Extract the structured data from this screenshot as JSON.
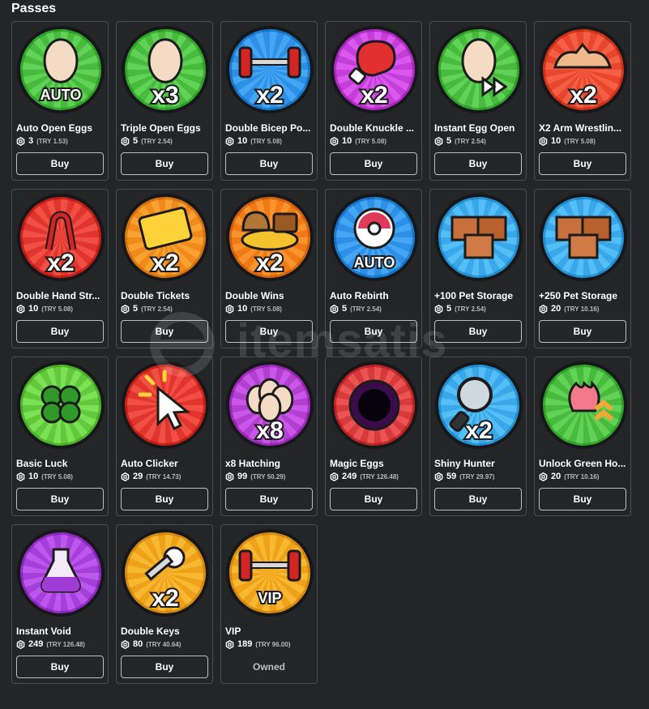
{
  "section_title": "Passes",
  "buy_label": "Buy",
  "watermark_text": "itemsatis",
  "passes": [
    {
      "name": "Auto Open Eggs",
      "price": "3",
      "try": "(TRY 1.53)",
      "icon": "egg-auto",
      "bg": "#48bb3f",
      "label": "AUTO",
      "status": "buy"
    },
    {
      "name": "Triple Open Eggs",
      "price": "5",
      "try": "(TRY 2.54)",
      "icon": "egg-x3",
      "bg": "#48bb3f",
      "label": "x3",
      "status": "buy"
    },
    {
      "name": "Double Bicep Po...",
      "price": "10",
      "try": "(TRY 5.08)",
      "icon": "dumbbell-x2",
      "bg": "#2d8fe6",
      "label": "x2",
      "status": "buy"
    },
    {
      "name": "Double Knuckle ...",
      "price": "10",
      "try": "(TRY 5.08)",
      "icon": "boxing-glove-x2",
      "bg": "#c43fd9",
      "label": "x2",
      "status": "buy"
    },
    {
      "name": "Instant Egg Open",
      "price": "5",
      "try": "(TRY 2.54)",
      "icon": "egg-fast-forward",
      "bg": "#48bb3f",
      "label": "",
      "status": "buy"
    },
    {
      "name": "X2 Arm Wrestlin...",
      "price": "10",
      "try": "(TRY 5.08)",
      "icon": "arm-wrestle-x2",
      "bg": "#e8472d",
      "label": "x2",
      "status": "buy"
    },
    {
      "name": "Double Hand Str...",
      "price": "10",
      "try": "(TRY 5.08)",
      "icon": "hand-gripper-x2",
      "bg": "#e0352c",
      "label": "x2",
      "status": "buy"
    },
    {
      "name": "Double Tickets",
      "price": "5",
      "try": "(TRY 2.54)",
      "icon": "ticket-x2",
      "bg": "#f08a1a",
      "label": "x2",
      "status": "buy"
    },
    {
      "name": "Double Wins",
      "price": "10",
      "try": "(TRY 5.08)",
      "icon": "treasure-x2",
      "bg": "#f07a16",
      "label": "x2",
      "status": "buy"
    },
    {
      "name": "Auto Rebirth",
      "price": "5",
      "try": "(TRY 2.54)",
      "icon": "rebirth-auto",
      "bg": "#2d8fe6",
      "label": "AUTO",
      "status": "buy"
    },
    {
      "name": "+100 Pet Storage",
      "price": "5",
      "try": "(TRY 2.54)",
      "icon": "boxes",
      "bg": "#3aa7ea",
      "label": "",
      "status": "buy"
    },
    {
      "name": "+250 Pet Storage",
      "price": "20",
      "try": "(TRY 10.16)",
      "icon": "boxes",
      "bg": "#3aa7ea",
      "label": "",
      "status": "buy"
    },
    {
      "name": "Basic Luck",
      "price": "10",
      "try": "(TRY 5.08)",
      "icon": "clover",
      "bg": "#62c93c",
      "label": "",
      "status": "buy"
    },
    {
      "name": "Auto Clicker",
      "price": "29",
      "try": "(TRY 14.73)",
      "icon": "cursor-click",
      "bg": "#e0352c",
      "label": "",
      "status": "buy"
    },
    {
      "name": "x8 Hatching",
      "price": "99",
      "try": "(TRY 50.29)",
      "icon": "eggs-x8",
      "bg": "#b23fd0",
      "label": "x8",
      "status": "buy"
    },
    {
      "name": "Magic Eggs",
      "price": "249",
      "try": "(TRY 126.48)",
      "icon": "void-orb",
      "bg": "#d63a3a",
      "label": "",
      "status": "buy"
    },
    {
      "name": "Shiny Hunter",
      "price": "59",
      "try": "(TRY 29.97)",
      "icon": "magnifier-x2",
      "bg": "#3aa7ea",
      "label": "x2",
      "status": "buy"
    },
    {
      "name": "Unlock Green Ho...",
      "price": "20",
      "try": "(TRY 10.16)",
      "icon": "flower-upgrade",
      "bg": "#48bb3f",
      "label": "",
      "status": "buy"
    },
    {
      "name": "Instant Void",
      "price": "249",
      "try": "(TRY 126.48)",
      "icon": "potion",
      "bg": "#a53fd9",
      "label": "",
      "status": "buy"
    },
    {
      "name": "Double Keys",
      "price": "80",
      "try": "(TRY 40.64)",
      "icon": "key-x2",
      "bg": "#f0a11a",
      "label": "x2",
      "status": "buy"
    },
    {
      "name": "VIP",
      "price": "189",
      "try": "(TRY 96.00)",
      "icon": "dumbbell-vip",
      "bg": "#f0a11a",
      "label": "VIP",
      "status": "owned",
      "status_text": "Owned"
    }
  ]
}
